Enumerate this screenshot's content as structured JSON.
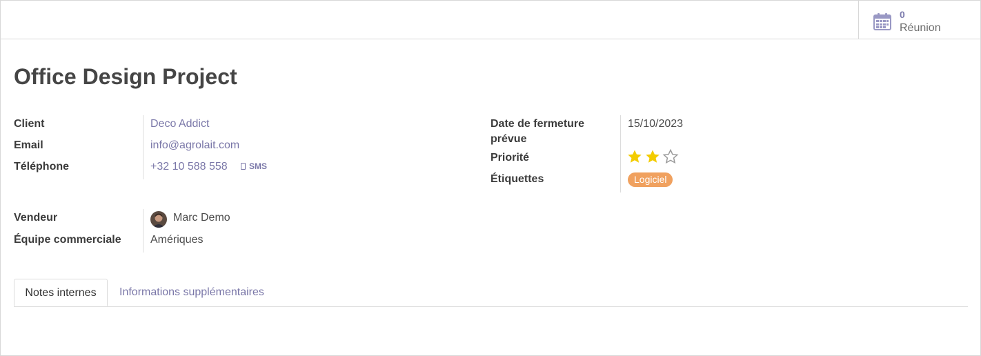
{
  "stat_button": {
    "value": "0",
    "label": "Réunion",
    "icon": "calendar-icon"
  },
  "title": "Office Design Project",
  "left_group": {
    "client_label": "Client",
    "client_value": "Deco Addict",
    "email_label": "Email",
    "email_value": "info@agrolait.com",
    "phone_label": "Téléphone",
    "phone_value": "+32 10 588 558",
    "sms_label": "SMS"
  },
  "right_group": {
    "closing_label": "Date de fermeture prévue",
    "closing_value": "15/10/2023",
    "priority_label": "Priorité",
    "priority_value": 2,
    "priority_max": 3,
    "tags_label": "Étiquettes",
    "tags": [
      "Logiciel"
    ]
  },
  "sales_group": {
    "salesperson_label": "Vendeur",
    "salesperson_value": "Marc Demo",
    "team_label": "Équipe commerciale",
    "team_value": "Amériques"
  },
  "tabs": [
    {
      "label": "Notes internes",
      "active": true
    },
    {
      "label": "Informations supplémentaires",
      "active": false
    }
  ],
  "colors": {
    "link": "#7a77a8",
    "star_filled": "#f3cc00",
    "star_empty": "#9a9a9a",
    "tag_bg": "#f0a15f"
  }
}
